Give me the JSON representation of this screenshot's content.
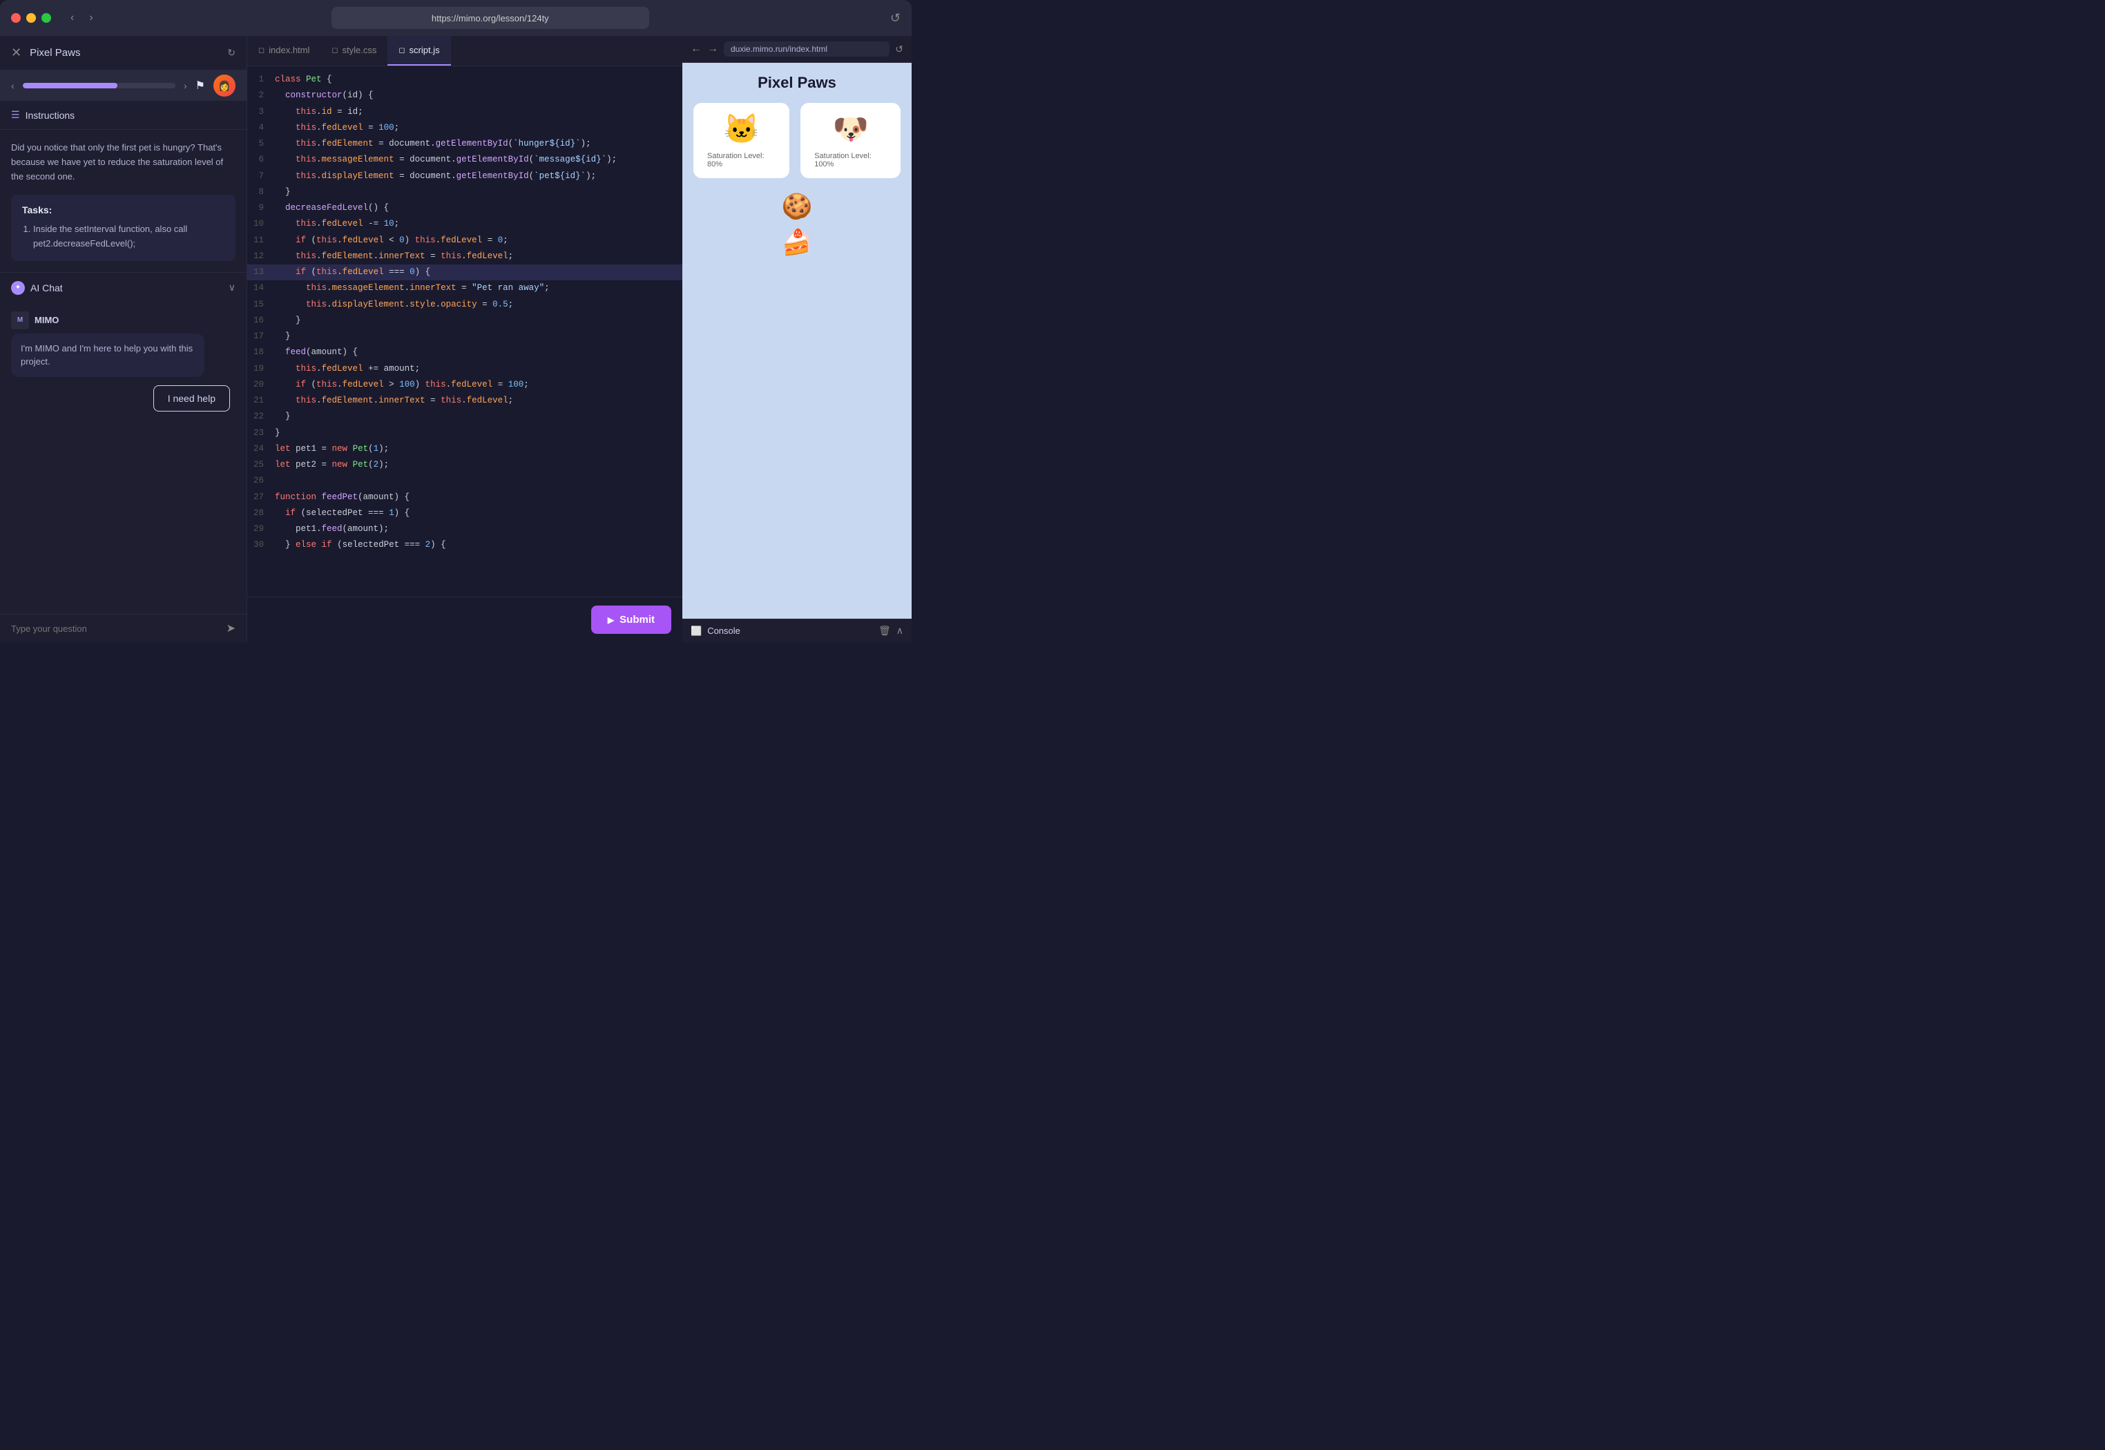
{
  "titleBar": {
    "url": "https://mimo.org/lesson/124ty",
    "refreshIcon": "↺"
  },
  "header": {
    "projectName": "Pixel Paws",
    "closeIcon": "✕",
    "projectIcon": "↻",
    "navBack": "‹",
    "navForward": "›",
    "progressPercent": 62,
    "flagIcon": "⚑",
    "refreshBtn": "↺"
  },
  "leftPanel": {
    "instructionsLabel": "Instructions",
    "instructionsText": "Did you notice that only the first pet is hungry? That's because we have yet to reduce the saturation level of the second one.",
    "tasksTitle": "Tasks:",
    "tasks": [
      "Inside the setInterval function, also call pet2.decreaseFedLevel();"
    ]
  },
  "aiChat": {
    "label": "AI Chat",
    "mimoBotName": "MIMO",
    "mimoBotMessage": "I'm MIMO and I'm here to help you with this project.",
    "helpButtonLabel": "I need help",
    "inputPlaceholder": "Type your question",
    "sendIcon": "➤"
  },
  "tabs": [
    {
      "label": "index.html",
      "icon": "◻",
      "active": false
    },
    {
      "label": "style.css",
      "icon": "◻",
      "active": false
    },
    {
      "label": "script.js",
      "icon": "◻",
      "active": true
    }
  ],
  "codeLines": [
    {
      "num": 1,
      "code": "class Pet {"
    },
    {
      "num": 2,
      "code": "  constructor(id) {"
    },
    {
      "num": 3,
      "code": "    this.id = id;"
    },
    {
      "num": 4,
      "code": "    this.fedLevel = 100;"
    },
    {
      "num": 5,
      "code": "    this.fedElement = document.getElementById(`hunger${id}`);"
    },
    {
      "num": 6,
      "code": "    this.messageElement = document.getElementById(`message${id}`);"
    },
    {
      "num": 7,
      "code": "    this.displayElement = document.getElementById(`pet${id}`);"
    },
    {
      "num": 8,
      "code": "  }"
    },
    {
      "num": 9,
      "code": "  decreaseFedLevel() {"
    },
    {
      "num": 10,
      "code": "    this.fedLevel -= 10;"
    },
    {
      "num": 11,
      "code": "    if (this.fedLevel < 0) this.fedLevel = 0;"
    },
    {
      "num": 12,
      "code": "    this.fedElement.innerText = this.fedLevel;"
    },
    {
      "num": 13,
      "code": "    if (this.fedLevel === 0) {",
      "highlight": true
    },
    {
      "num": 14,
      "code": "      this.messageElement.innerText = \"Pet ran away\";"
    },
    {
      "num": 15,
      "code": "      this.displayElement.style.opacity = 0.5;"
    },
    {
      "num": 16,
      "code": "    }"
    },
    {
      "num": 17,
      "code": "  }"
    },
    {
      "num": 18,
      "code": "  feed(amount) {"
    },
    {
      "num": 19,
      "code": "    this.fedLevel += amount;"
    },
    {
      "num": 20,
      "code": "    if (this.fedLevel > 100) this.fedLevel = 100;"
    },
    {
      "num": 21,
      "code": "    this.fedElement.innerText = this.fedLevel;"
    },
    {
      "num": 22,
      "code": "  }"
    },
    {
      "num": 23,
      "code": "}"
    },
    {
      "num": 24,
      "code": "let pet1 = new Pet(1);"
    },
    {
      "num": 25,
      "code": "let pet2 = new Pet(2);"
    },
    {
      "num": 26,
      "code": ""
    },
    {
      "num": 27,
      "code": "function feedPet(amount) {"
    },
    {
      "num": 28,
      "code": "  if (selectedPet === 1) {"
    },
    {
      "num": 29,
      "code": "    pet1.feed(amount);"
    },
    {
      "num": 30,
      "code": "  } else if (selectedPet === 2) {"
    }
  ],
  "submitBtn": "Submit",
  "preview": {
    "url": "duxie.mimo.run/index.html",
    "title": "Pixel Paws",
    "pets": [
      {
        "emoji": "🐱",
        "saturation": "Saturation Level: 80%"
      },
      {
        "emoji": "🐶",
        "saturation": "Saturation Level: 100%"
      }
    ],
    "foods": [
      "🍪",
      "🍰"
    ]
  },
  "console": {
    "label": "Console",
    "icon": "⬜",
    "deleteIcon": "🗑",
    "collapseIcon": "∧"
  }
}
